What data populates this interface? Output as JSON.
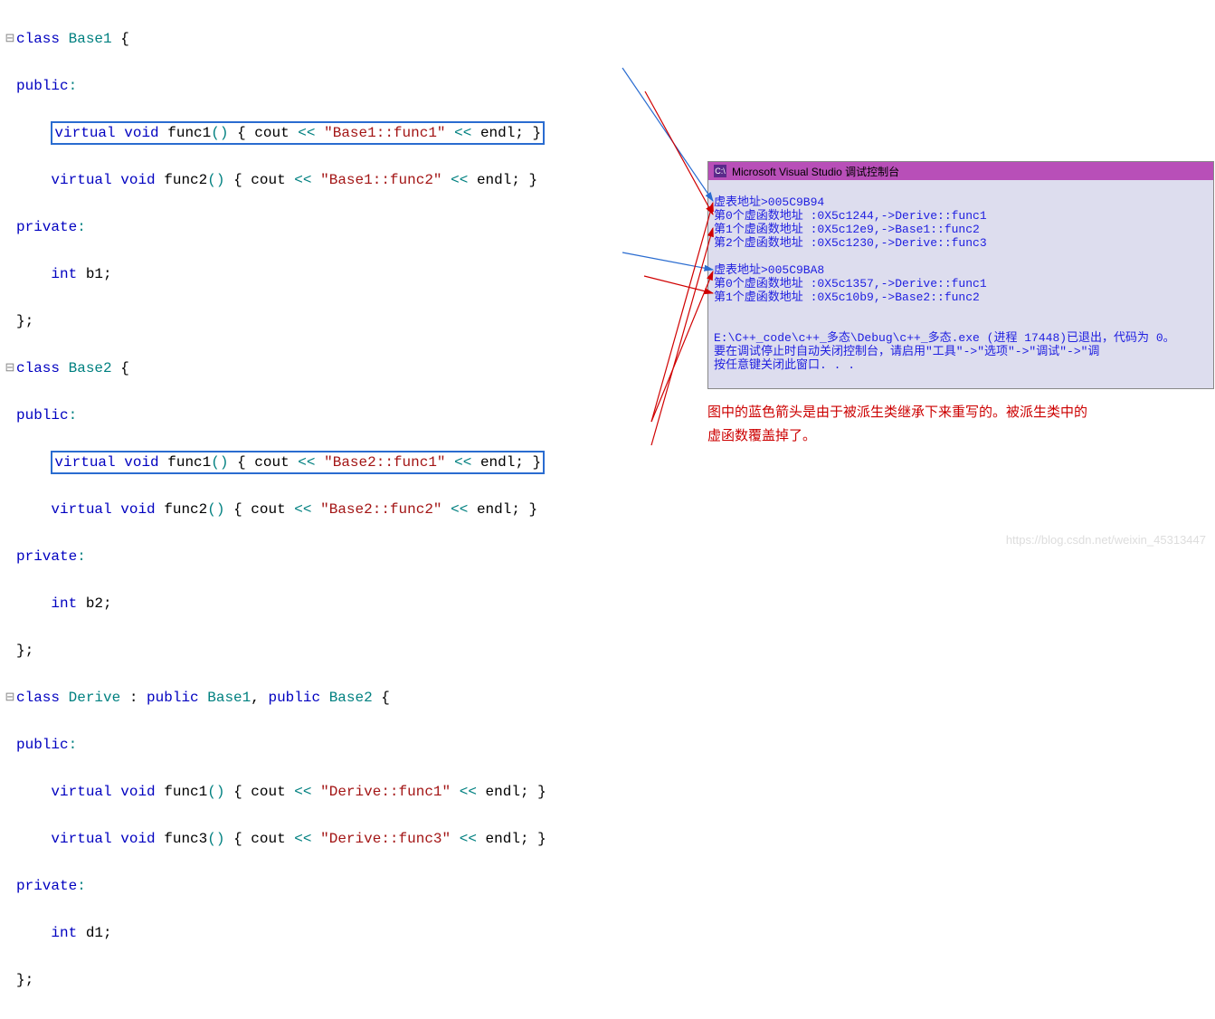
{
  "code": {
    "base1": {
      "decl": "Base1",
      "public": "public",
      "func1": {
        "sig_pre": "virtual void ",
        "name": "func1",
        "sig_post": "() { ",
        "cout": "cout",
        "op": " << ",
        "str": "\"Base1::func1\"",
        "op2": " << ",
        "endl": "endl",
        "tail": "; }"
      },
      "func2": {
        "sig_pre": "virtual void ",
        "name": "func2",
        "sig_post": "() { ",
        "cout": "cout",
        "op": " << ",
        "str": "\"Base1::func2\"",
        "op2": " << ",
        "endl": "endl",
        "tail": "; }"
      },
      "private": "private",
      "member": {
        "type": "int ",
        "name": "b1",
        "tail": ";"
      }
    },
    "base2": {
      "decl": "Base2",
      "public": "public",
      "func1": {
        "sig_pre": "virtual void ",
        "name": "func1",
        "sig_post": "() { ",
        "cout": "cout",
        "op": " << ",
        "str": "\"Base2::func1\"",
        "op2": " << ",
        "endl": "endl",
        "tail": "; }"
      },
      "func2": {
        "sig_pre": "virtual void ",
        "name": "func2",
        "sig_post": "() { ",
        "cout": "cout",
        "op": " << ",
        "str": "\"Base2::func2\"",
        "op2": " << ",
        "endl": "endl",
        "tail": "; }"
      },
      "private": "private",
      "member": {
        "type": "int ",
        "name": "b2",
        "tail": ";"
      }
    },
    "derive": {
      "decl": "Derive",
      "inherit_pre": " : ",
      "pub1": "public ",
      "b1": "Base1",
      "sep": ", ",
      "pub2": "public ",
      "b2": "Base2",
      "public": "public",
      "func1": {
        "sig_pre": "virtual void ",
        "name": "func1",
        "sig_post": "() { ",
        "cout": "cout",
        "op": " << ",
        "str": "\"Derive::func1\"",
        "op2": " << ",
        "endl": "endl",
        "tail": "; }"
      },
      "func3": {
        "sig_pre": "virtual void ",
        "name": "func3",
        "sig_post": "() { ",
        "cout": "cout",
        "op": " << ",
        "str": "\"Derive::func3\"",
        "op2": " << ",
        "endl": "endl",
        "tail": "; }"
      },
      "private": "private",
      "member": {
        "type": "int ",
        "name": "d1",
        "tail": ";"
      }
    },
    "kw": {
      "class": "class ",
      "virtual": "virtual ",
      "void": "void "
    }
  },
  "console": {
    "title": "Microsoft Visual Studio 调试控制台",
    "lines": [
      "虚表地址>005C9B94",
      "第0个虚函数地址 :0X5c1244,->Derive::func1",
      "第1个虚函数地址 :0X5c12e9,->Base1::func2",
      "第2个虚函数地址 :0X5c1230,->Derive::func3",
      "",
      "虚表地址>005C9BA8",
      "第0个虚函数地址 :0X5c1357,->Derive::func1",
      "第1个虚函数地址 :0X5c10b9,->Base2::func2",
      "",
      "",
      "E:\\C++_code\\c++_多态\\Debug\\c++_多态.exe (进程 17448)已退出，代码为 0。",
      "要在调试停止时自动关闭控制台，请启用\"工具\"->\"选项\"->\"调试\"->\"调",
      "按任意键关闭此窗口. . ."
    ]
  },
  "annotation": {
    "line1": "图中的蓝色箭头是由于被派生类继承下来重写的。被派生类中的",
    "line2": "虚函数覆盖掉了。"
  },
  "watermark": "https://blog.csdn.net/weixin_45313447"
}
